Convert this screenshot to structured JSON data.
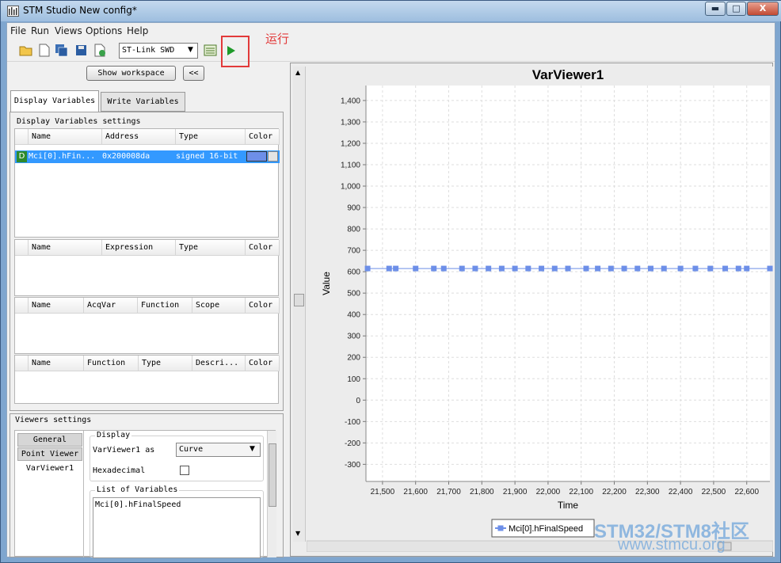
{
  "window": {
    "title": "STM Studio New config*",
    "minimize": "▬",
    "maximize": "□",
    "close": "X"
  },
  "menu": [
    "File",
    "Run",
    "Views",
    "Options",
    "Help"
  ],
  "toolbar": {
    "probe": "ST-Link SWD",
    "annotation": "运行"
  },
  "left": {
    "show_workspace": "Show workspace",
    "collapse": "<<",
    "tabs": {
      "display": "Display Variables",
      "write": "Write Variables"
    },
    "settings_title": "Display Variables settings",
    "var_table": {
      "headers": [
        "Name",
        "Address",
        "Type",
        "Color"
      ],
      "row": {
        "badge": "D",
        "name": "Mci[0].hFin...",
        "address": "0x200008da",
        "type": "signed 16-bit"
      }
    },
    "expr_table": {
      "headers": [
        "Name",
        "Expression",
        "Type",
        "Color"
      ]
    },
    "acq_table": {
      "headers": [
        "Name",
        "AcqVar",
        "Function",
        "Scope",
        "Color"
      ]
    },
    "func_table": {
      "headers": [
        "Name",
        "Function",
        "Type",
        "Descri...",
        "Color"
      ]
    },
    "viewers_title": "Viewers settings",
    "viewer_tabs": [
      "General",
      "Point Viewer",
      "VarViewer1"
    ],
    "display_group": "Display",
    "viewer_as_label": "VarViewer1 as",
    "viewer_as_value": "Curve",
    "hexadecimal": "Hexadecimal",
    "list_group": "List of Variables",
    "list_item": "Mci[0].hFinalSpeed"
  },
  "watermark": {
    "line1": "STM32/STM8社区",
    "line2": "www.stmcu.org"
  },
  "chart_data": {
    "type": "line",
    "title": "VarViewer1",
    "xlabel": "Time",
    "ylabel": "Value",
    "xlim": [
      21450,
      22670
    ],
    "ylim": [
      -380,
      1470
    ],
    "xticks": [
      "21,500",
      "21,600",
      "21,700",
      "21,800",
      "21,900",
      "22,000",
      "22,100",
      "22,200",
      "22,300",
      "22,400",
      "22,500",
      "22,600"
    ],
    "yticks": [
      "1,400",
      "1,300",
      "1,200",
      "1,100",
      "1,000",
      "900",
      "800",
      "700",
      "600",
      "500",
      "400",
      "300",
      "200",
      "100",
      "0",
      "-100",
      "-200",
      "-300"
    ],
    "grid": true,
    "legend": "bottom-center",
    "series": [
      {
        "name": "Mci[0].hFinalSpeed",
        "color": "#6d8fe8",
        "x": [
          21455,
          21520,
          21540,
          21600,
          21655,
          21685,
          21740,
          21780,
          21820,
          21860,
          21900,
          21940,
          21980,
          22020,
          22060,
          22115,
          22150,
          22190,
          22230,
          22270,
          22310,
          22350,
          22400,
          22445,
          22490,
          22535,
          22575,
          22600,
          22670
        ],
        "y": [
          615,
          615,
          615,
          615,
          615,
          615,
          615,
          615,
          615,
          615,
          615,
          615,
          615,
          615,
          615,
          615,
          615,
          615,
          615,
          615,
          615,
          615,
          615,
          615,
          615,
          615,
          615,
          615,
          615
        ]
      }
    ]
  }
}
